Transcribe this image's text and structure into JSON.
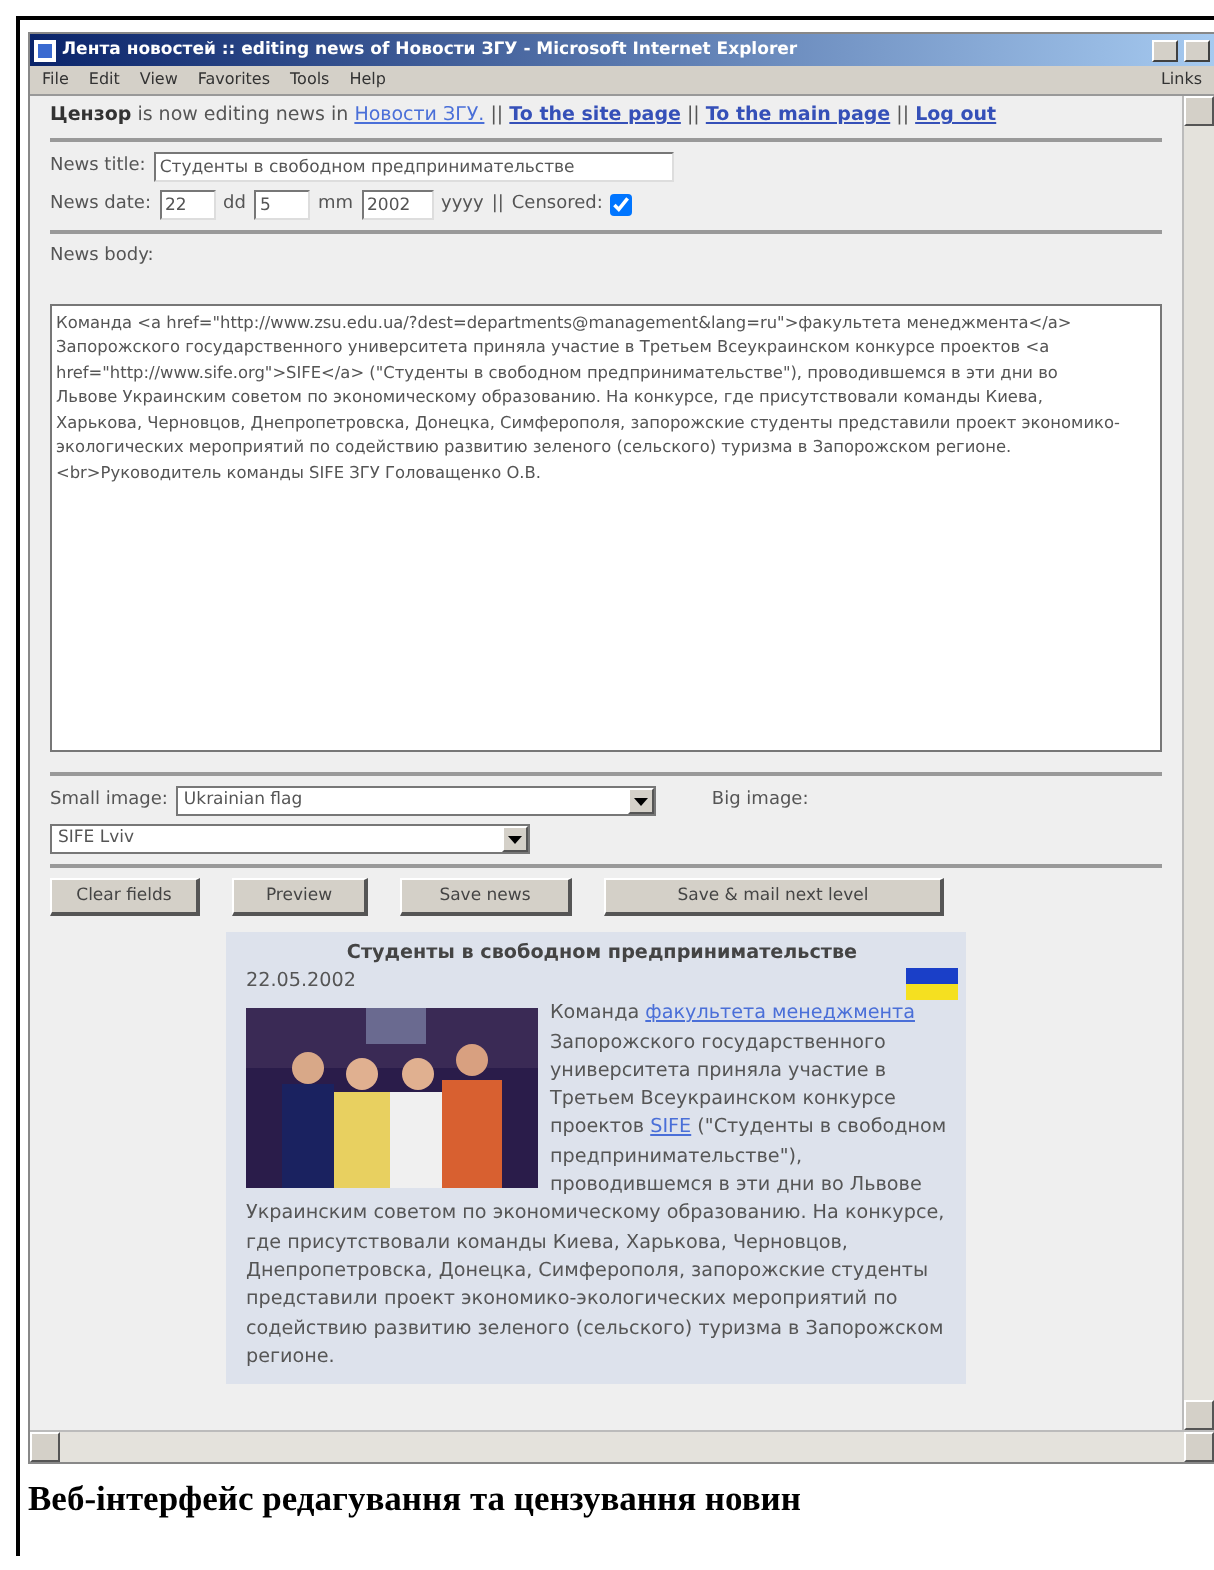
{
  "window": {
    "title": "Лента новостей :: editing news of Новости ЗГУ - Microsoft Internet Explorer"
  },
  "menu": [
    "File",
    "Edit",
    "View",
    "Favorites",
    "Tools",
    "Help"
  ],
  "links_label": "Links",
  "header": [
    {
      "kind": "user",
      "text": "Цензор"
    },
    {
      "kind": "text",
      "text": "is now editing news in"
    },
    {
      "kind": "link",
      "text": "Новости ЗГУ."
    },
    {
      "kind": "text",
      "text": "||"
    },
    {
      "kind": "strong_link",
      "text": "To the site page"
    },
    {
      "kind": "text",
      "text": "||"
    },
    {
      "kind": "strong_link",
      "text": "To the main page"
    },
    {
      "kind": "text",
      "text": "||"
    },
    {
      "kind": "strong_link",
      "text": "Log out"
    }
  ],
  "form": {
    "title_label": "News title:",
    "title_value": "Студенты в свободном предпринимательстве",
    "date_label": "News date:",
    "day": "22",
    "day_unit": "dd",
    "month": "5",
    "month_unit": "mm",
    "year": "2002",
    "year_unit": "yyyy",
    "separator": "||",
    "censored_label": "Censored:",
    "censored": true,
    "body_label": "News body:",
    "body": "Команда <a href=\"http://www.zsu.edu.ua/?dest=departments@management&lang=ru\">факультета менеджмента</a> Запорожского государственного университета приняла участие в Третьем Всеукраинском конкурсе проектов <a href=\"http://www.sife.org\">SIFE</a> (\"Студенты в свободном предпринимательстве\"), проводившемся в эти дни во Львове Украинским советом по экономическому образованию. На конкурсе, где присутствовали команды Киева, Харькова, Черновцов, Днепропетровска, Донецка, Симферополя, запорожские студенты представили проект экономико-экологических мероприятий по содействию развитию зеленого (сельского) туризма в Запорожском регионе. <br>Руководитель команды SIFE ЗГУ Головащенко О.В.",
    "small_image_label": "Small image:",
    "small_image_value": "Ukrainian flag",
    "big_image_label": "Big image:",
    "big_image_value": "SIFE Lviv"
  },
  "buttons": [
    "Clear fields",
    "Preview",
    "Save news",
    "Save & mail next level"
  ],
  "preview": {
    "title": "Студенты в свободном предпринимательстве",
    "date": "22.05.2002",
    "image": {
      "kind": "picture"
    },
    "paragraphs": [
      [
        {
          "kind": "text",
          "text": "Команда"
        },
        {
          "kind": "link",
          "text": "факультета менеджмента"
        },
        {
          "kind": "text",
          "text": "Запорожского государственного университета приняла участие в Третьем Всеукраинском конкурсе проектов"
        },
        {
          "kind": "link",
          "text": "SIFE"
        },
        {
          "kind": "text",
          "text": "(\"Студенты в свободном предпринимательстве\"), проводившемся в эти дни во Львове"
        }
      ],
      [
        {
          "kind": "text",
          "text": "Украинским советом по экономическому образованию. На конкурсе, где присутствовали команды Киева, Харькова, Черновцов, Днепропетровска, Донецка, Симферополя, запорожские студенты представили проект экономико-экологических мероприятий по содействию развитию зеленого (сельского) туризма в Запорожском регионе."
        }
      ]
    ]
  },
  "caption": "Веб-інтерфейс редагування та цензування новин"
}
